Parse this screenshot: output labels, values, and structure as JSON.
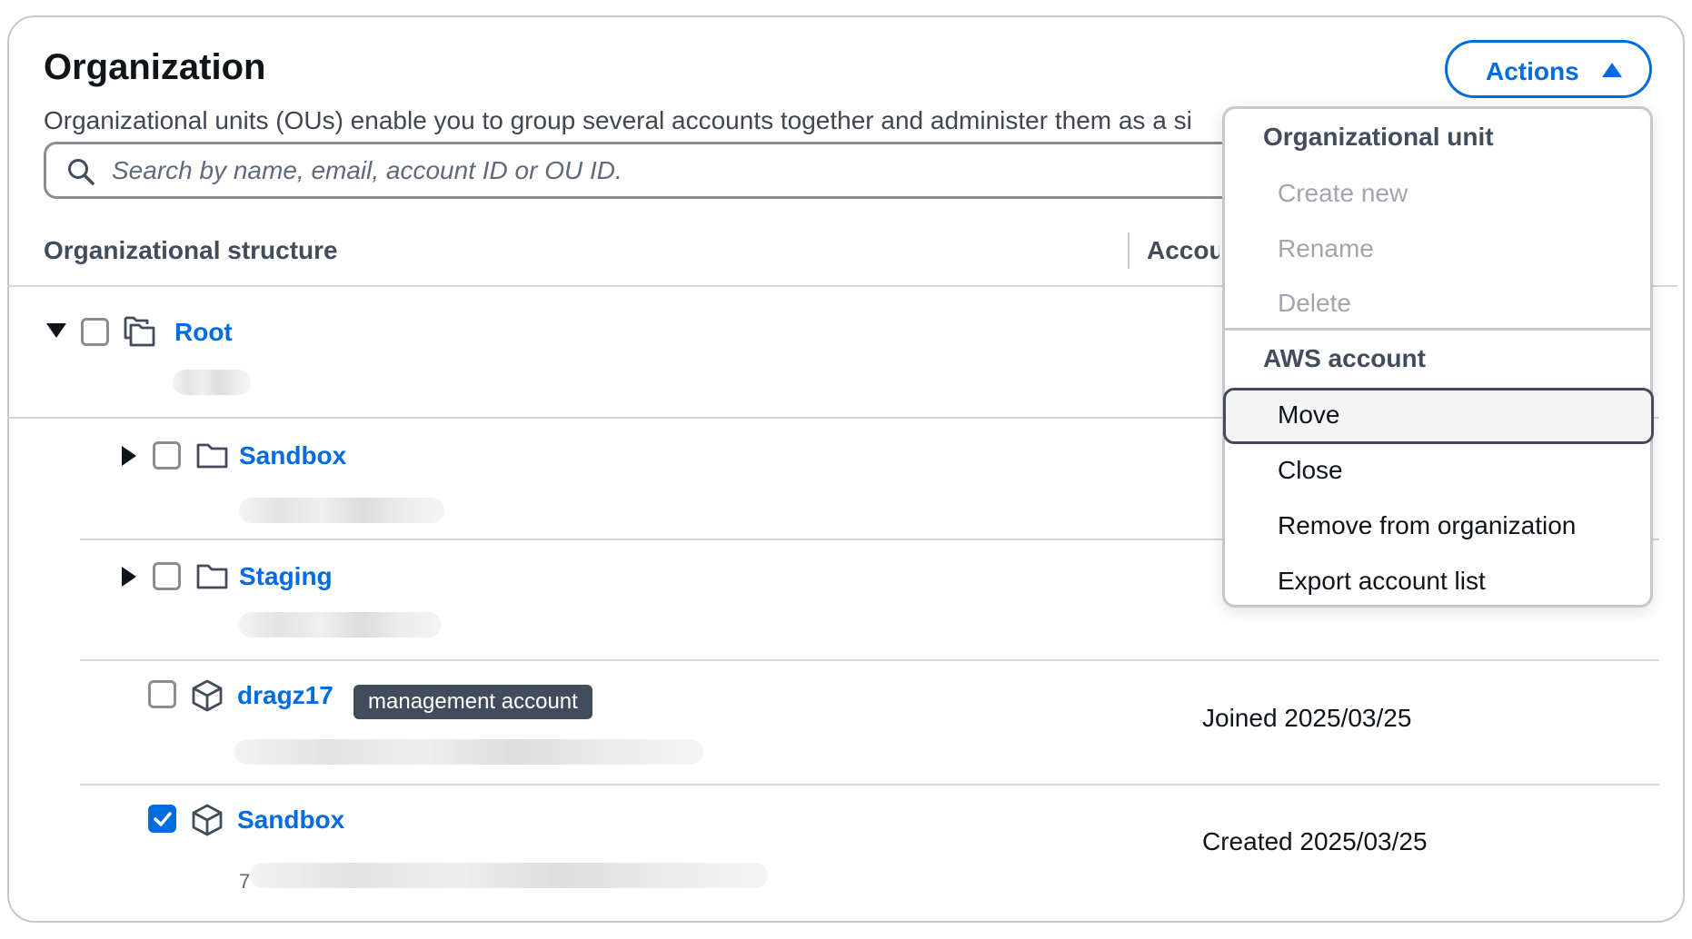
{
  "header": {
    "title": "Organization",
    "description": "Organizational units (OUs) enable you to group several accounts together and administer them as a si",
    "actions_label": "Actions"
  },
  "search": {
    "placeholder": "Search by name, email, account ID or OU ID."
  },
  "table": {
    "columns": [
      "Organizational structure",
      "Accou"
    ]
  },
  "tree": {
    "root": {
      "label": "Root"
    },
    "ou_sandbox": {
      "label": "Sandbox"
    },
    "ou_staging": {
      "label": "Staging"
    },
    "account_dragz17": {
      "label": "dragz17",
      "badge": "management account",
      "status": "Joined 2025/03/25"
    },
    "account_sandbox": {
      "label": "Sandbox",
      "status": "Created 2025/03/25",
      "id_prefix": "7",
      "checked": true
    }
  },
  "menu": {
    "groups": [
      {
        "heading": "Organizational unit",
        "items": [
          "Create new",
          "Rename",
          "Delete"
        ]
      },
      {
        "heading": "AWS account",
        "items": [
          "Move",
          "Close",
          "Remove from organization",
          "Export account list"
        ]
      }
    ],
    "highlighted_item": "Move"
  },
  "colors": {
    "link": "#006ce0",
    "badge_bg": "#414d5c",
    "checkbox_checked": "#006ce0",
    "disabled_text": "#a4a4ad"
  }
}
